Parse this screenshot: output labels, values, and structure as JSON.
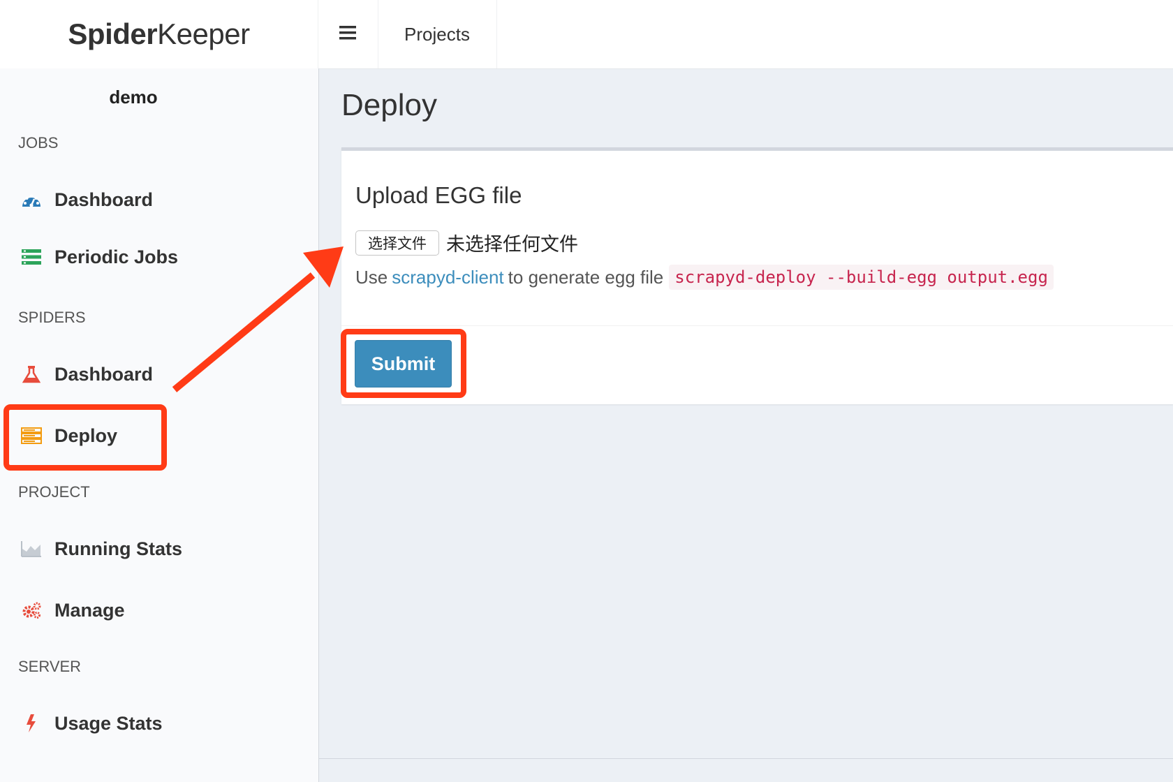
{
  "header": {
    "logo_bold": "Spider",
    "logo_light": "Keeper",
    "menu_icon": "hamburger-icon",
    "projects_label": "Projects"
  },
  "sidebar": {
    "project_name": "demo",
    "sections": [
      {
        "title": "JOBS",
        "items": [
          {
            "label": "Dashboard",
            "icon": "dashboard-gauge-icon",
            "color": "#2a7ab7"
          },
          {
            "label": "Periodic Jobs",
            "icon": "list-icon",
            "color": "#2ca45a"
          }
        ]
      },
      {
        "title": "SPIDERS",
        "items": [
          {
            "label": "Dashboard",
            "icon": "flask-icon",
            "color": "#e74c3c"
          },
          {
            "label": "Deploy",
            "icon": "server-icon",
            "color": "#f39c12",
            "active": true
          }
        ]
      },
      {
        "title": "PROJECT",
        "items": [
          {
            "label": "Running Stats",
            "icon": "area-chart-icon",
            "color": "#b8c0c8"
          },
          {
            "label": "Manage",
            "icon": "cogs-icon",
            "color": "#e74c3c"
          }
        ]
      },
      {
        "title": "SERVER",
        "items": [
          {
            "label": "Usage Stats",
            "icon": "bolt-icon",
            "color": "#e74c3c"
          }
        ]
      }
    ]
  },
  "main": {
    "title": "Deploy",
    "box_title": "Upload EGG file",
    "file_button": "选择文件",
    "file_status": "未选择任何文件",
    "help_prefix": "Use",
    "help_link": "scrapyd-client",
    "help_middle": "to generate egg file",
    "help_code": "scrapyd-deploy --build-egg output.egg",
    "submit_label": "Submit"
  },
  "colors": {
    "accent": "#3c8dbc",
    "annotation": "#ff3b16",
    "code": "#c7254e"
  }
}
